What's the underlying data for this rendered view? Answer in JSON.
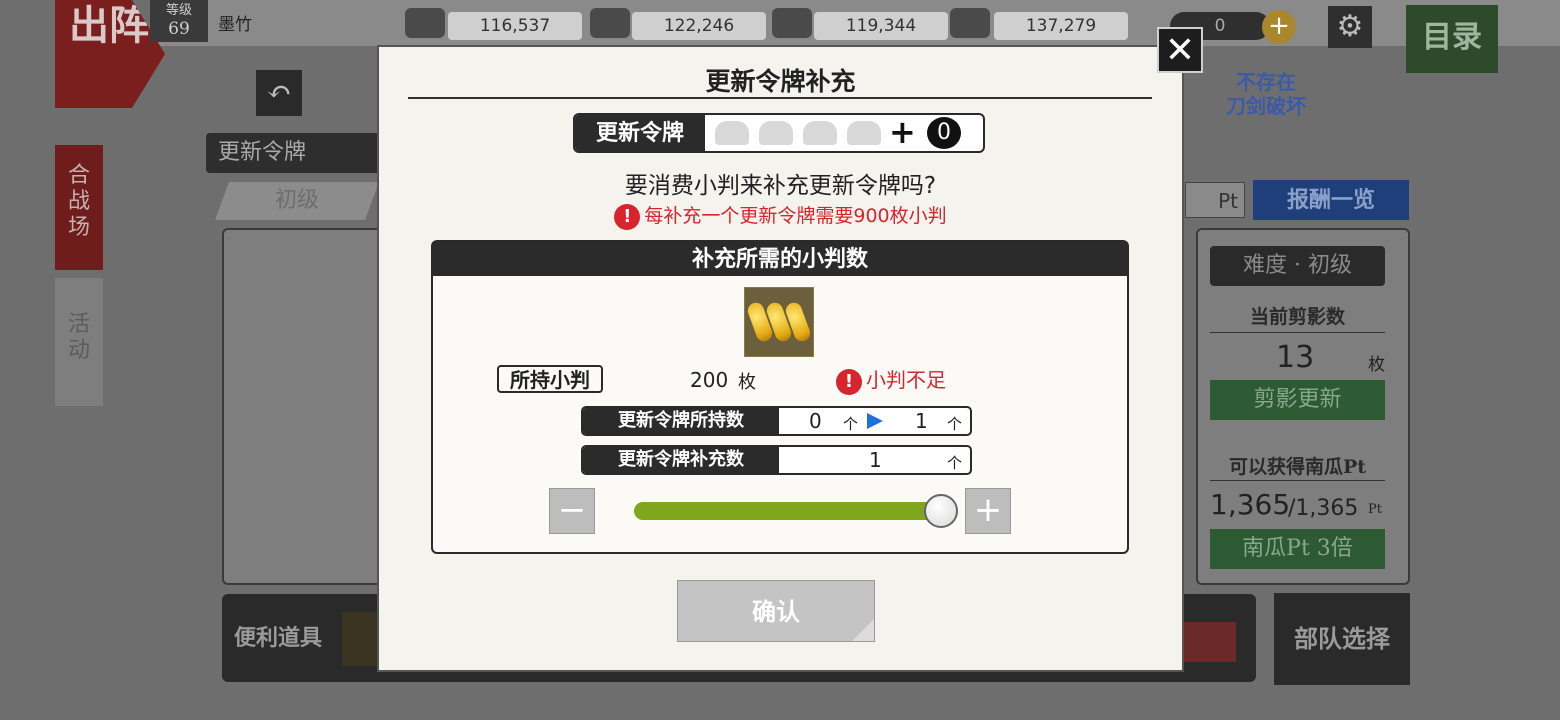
{
  "header": {
    "sortie_label": "出阵",
    "level_label": "等级",
    "level_value": "69",
    "player_name": "墨竹",
    "resources": [
      {
        "icon": "charcoal-icon",
        "value": "116,537"
      },
      {
        "icon": "steel-icon",
        "value": "122,246"
      },
      {
        "icon": "cooling-material-icon",
        "value": "119,344"
      },
      {
        "icon": "whetstone-icon",
        "value": "137,279"
      }
    ],
    "gold_value": "0",
    "menu_label": "目录"
  },
  "background": {
    "no_destroy_label": "不存在\n刀剑破坏",
    "token_bar_label": "更新令牌",
    "side_tabs": [
      "合\n战\n场",
      "活\n动"
    ],
    "tab_basic": "初级",
    "pt_label": "Pt",
    "reward_list": "报酬一览",
    "difficulty": "难度 · 初级",
    "current_silhouette_label": "当前剪影数",
    "current_silhouette_value": "13",
    "current_silhouette_unit": "枚",
    "silhouette_update": "剪影更新",
    "pumpkin_pt_label": "可以获得南瓜Pt",
    "pumpkin_pt_current": "1,365",
    "pumpkin_pt_max": "/1,365",
    "pumpkin_pt_unit": "Pt",
    "pumpkin_bonus": "南瓜Pt 3倍",
    "convenience_items": "便利道具",
    "unit_select": "部队选择"
  },
  "modal": {
    "title": "更新令牌补充",
    "token_label": "更新令牌",
    "token_count": "0",
    "question": "要消费小判来补充更新令牌吗?",
    "warning": "每补充一个更新令牌需要900枚小判",
    "required_header": "补充所需的小判数",
    "held_label": "所持小判",
    "held_value": "200",
    "held_unit": "枚",
    "insufficient": "小判不足",
    "owned_label": "更新令牌所持数",
    "owned_before": "0",
    "owned_after": "1",
    "unit": "个",
    "supply_label": "更新令牌补充数",
    "supply_value": "1",
    "slider_fraction": 1.0,
    "confirm_label": "确认",
    "colors": {
      "accent_red": "#d8242c",
      "slider_green": "#7fa61c",
      "arrow_blue": "#1f6fe0"
    }
  }
}
